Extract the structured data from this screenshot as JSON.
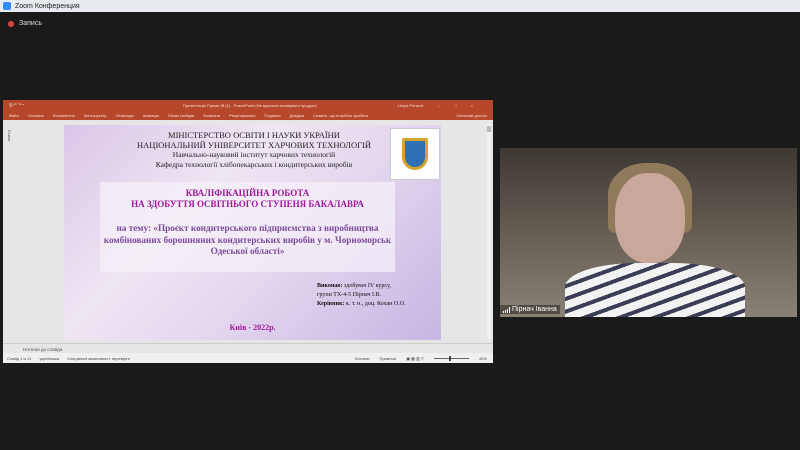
{
  "window": {
    "title": "Zoom Конференция"
  },
  "recording": {
    "label": "Запись"
  },
  "ppt": {
    "title": "Презентація Пірнач ІВ (1) - PowerPoint (Не вдалося активувати продукт)",
    "user": "Lesya Pirnach",
    "tabs": [
      "Файл",
      "Основне",
      "Вставлення",
      "Конструктор",
      "Переходи",
      "Анімація",
      "Показ слайдів",
      "Записати",
      "Рецензування",
      "Подання",
      "Довідка"
    ],
    "tell_me": "Скажіть, що потрібно зробити",
    "share": "Спільний доступ",
    "side_label": "Ескізи",
    "notes": "Нотатки до слайда",
    "status": {
      "slide": "Слайд 1 із 11",
      "language": "українська",
      "accessibility": "Спеціальні можливості: перевірте",
      "notes": "Нотатки",
      "comments": "Примітки",
      "zoom": "45%"
    }
  },
  "slide": {
    "line1": "МІНІСТЕРСТВО ОСВІТИ І НАУКИ УКРАЇНИ",
    "line2": "НАЦІОНАЛЬНИЙ  УНІВЕРСИТЕТ ХАРЧОВИХ ТЕХНОЛОГІЙ",
    "line3": "Навчально-науковий інститут харчових технологій",
    "line4": "Кафедра технології хлібопекарських і кондитерських виробів",
    "kv1": "КВАЛІФІКАЦІЙНА РОБОТА",
    "kv2": "НА ЗДОБУТТЯ ОСВІТНЬОГО СТУПЕНЯ БАКАЛАВРА",
    "topic": "на тему: «Проєкт кондитерського підприємства з виробництва комбінованих борошняних кондитерських виробів у м. Чорноморськ Одеської області»",
    "exec_label": "Виконав:",
    "exec_value": " здобувач IV курсу,",
    "group": "групи ТХ-4-5 Пірнач І.В.",
    "sup_label": "Керівник:",
    "sup_value": " к. т. н., доц. Кохан О.О.",
    "city": "Київ - 2022р."
  },
  "participant": {
    "name": "Пірнач Іванна"
  }
}
